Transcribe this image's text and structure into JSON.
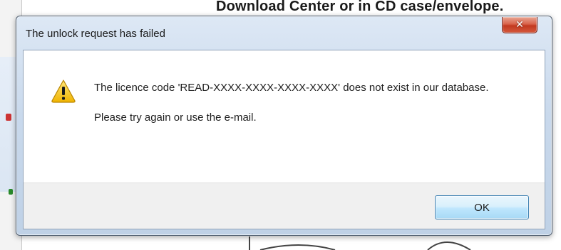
{
  "background": {
    "header_text": "Download Center or in CD case/envelope."
  },
  "dialog": {
    "title": "The unlock request has failed",
    "icon": "warning-icon",
    "message_line1": "The licence code 'READ-XXXX-XXXX-XXXX-XXXX' does not exist in our database.",
    "message_line2": "Please try again or use the e-mail.",
    "ok_label": "OK",
    "close_glyph": "✕"
  },
  "colors": {
    "warning_fill": "#f5c400",
    "close_button": "#c8422a",
    "ok_border": "#3c7fb1"
  }
}
